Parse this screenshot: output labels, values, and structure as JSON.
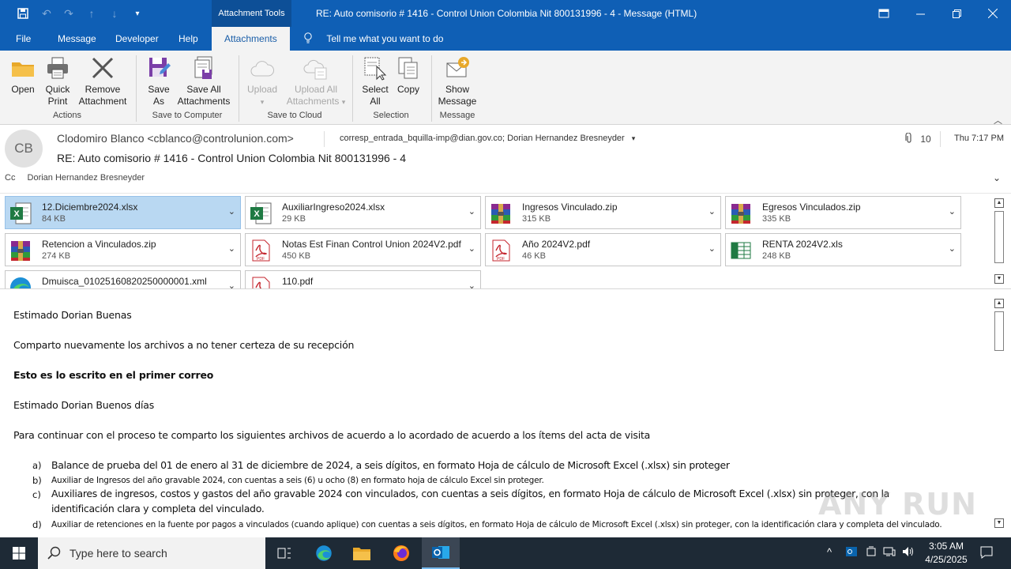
{
  "titlebar": {
    "context_tools": "Attachment Tools",
    "window_title": "RE: Auto comisorio # 1416 - Control Union Colombia Nit 800131996 - 4  -  Message (HTML)"
  },
  "tabs": [
    {
      "label": "File"
    },
    {
      "label": "Message"
    },
    {
      "label": "Developer"
    },
    {
      "label": "Help"
    },
    {
      "label": "Attachments"
    }
  ],
  "tellme": "Tell me what you want to do",
  "ribbon": {
    "open": "Open",
    "quick_print_1": "Quick",
    "quick_print_2": "Print",
    "remove_1": "Remove",
    "remove_2": "Attachment",
    "group_actions": "Actions",
    "save_as_1": "Save",
    "save_as_2": "As",
    "save_all_1": "Save All",
    "save_all_2": "Attachments",
    "group_save_computer": "Save to Computer",
    "upload_1": "Upload",
    "upload_all_1": "Upload All",
    "upload_all_2": "Attachments",
    "group_save_cloud": "Save to Cloud",
    "select_all_1": "Select",
    "select_all_2": "All",
    "copy": "Copy",
    "group_selection": "Selection",
    "show_message_1": "Show",
    "show_message_2": "Message",
    "group_message": "Message"
  },
  "header": {
    "avatar_initials": "CB",
    "sender": "Clodomiro Blanco <cblanco@controlunion.com>",
    "recipients": "corresp_entrada_bquilla-imp@dian.gov.co; Dorian Hernandez Bresneyder",
    "attachment_count": "10",
    "time": "Thu 7:17 PM",
    "subject": "RE: Auto comisorio # 1416 - Control Union Colombia Nit 800131996 - 4",
    "cc_label": "Cc",
    "cc_value": "Dorian Hernandez Bresneyder"
  },
  "attachments": [
    {
      "name": "12.Diciembre2024.xlsx",
      "size": "84 KB",
      "icon": "excel-icon"
    },
    {
      "name": "AuxiliarIngreso2024.xlsx",
      "size": "29 KB",
      "icon": "excel-icon"
    },
    {
      "name": "Ingresos Vinculado.zip",
      "size": "315 KB",
      "icon": "winrar-icon"
    },
    {
      "name": "Egresos Vinculados.zip",
      "size": "335 KB",
      "icon": "winrar-icon"
    },
    {
      "name": "Retencion a Vinculados.zip",
      "size": "274 KB",
      "icon": "winrar-icon"
    },
    {
      "name": "Notas  Est  Finan Control Union 2024V2.pdf",
      "size": "450 KB",
      "icon": "pdf-icon"
    },
    {
      "name": "Año 2024V2.pdf",
      "size": "46 KB",
      "icon": "pdf-icon"
    },
    {
      "name": "RENTA  2024V2.xls",
      "size": "248 KB",
      "icon": "excel-icon"
    },
    {
      "name": "Dmuisca_01025160820250000001.xml",
      "size": "",
      "icon": "edge-icon"
    },
    {
      "name": "110.pdf",
      "size": "",
      "icon": "pdf-icon"
    }
  ],
  "body": {
    "p1": "Estimado Dorian Buenas",
    "p2": "Comparto nuevamente los archivos a no tener certeza de su recepción",
    "p3": "Esto es lo escrito en el primer correo",
    "p4": "Estimado Dorian Buenos días",
    "p5": "Para continuar con el proceso te comparto los siguientes archivos de acuerdo a lo acordado de acuerdo a los ítems del acta de visita",
    "items": [
      {
        "marker": "a)",
        "text": "Balance de prueba del 01 de enero al 31 de diciembre de 2024, a seis dígitos, en formato Hoja de cálculo de Microsoft Excel (.xlsx) sin proteger"
      },
      {
        "marker": "b)",
        "text": "Auxiliar de Ingresos del año gravable 2024, con cuentas a seis (6) u ocho (8) en formato hoja de cálculo Excel sin proteger."
      },
      {
        "marker": "c)",
        "text": "Auxiliares de ingresos, costos y gastos del año gravable 2024 con vinculados, con cuentas a seis dígitos, en formato Hoja de cálculo de Microsoft Excel (.xlsx) sin proteger, con la",
        "text2": "identificación clara y completa del vinculado."
      },
      {
        "marker": "d)",
        "text": "Auxiliar de retenciones en la fuente por pagos a vinculados (cuando aplique) con cuentas a seis dígitos, en formato Hoja de cálculo de Microsoft Excel (.xlsx) sin proteger, con la identificación clara y completa del vinculado."
      }
    ]
  },
  "watermark": "ANY RUN",
  "taskbar": {
    "search_placeholder": "Type here to search",
    "time": "3:05 AM",
    "date": "4/25/2025"
  },
  "colors": {
    "title_blue": "#0f5fb5",
    "selected_attachment": "#b9d8f2",
    "taskbar": "#1e2a36"
  }
}
